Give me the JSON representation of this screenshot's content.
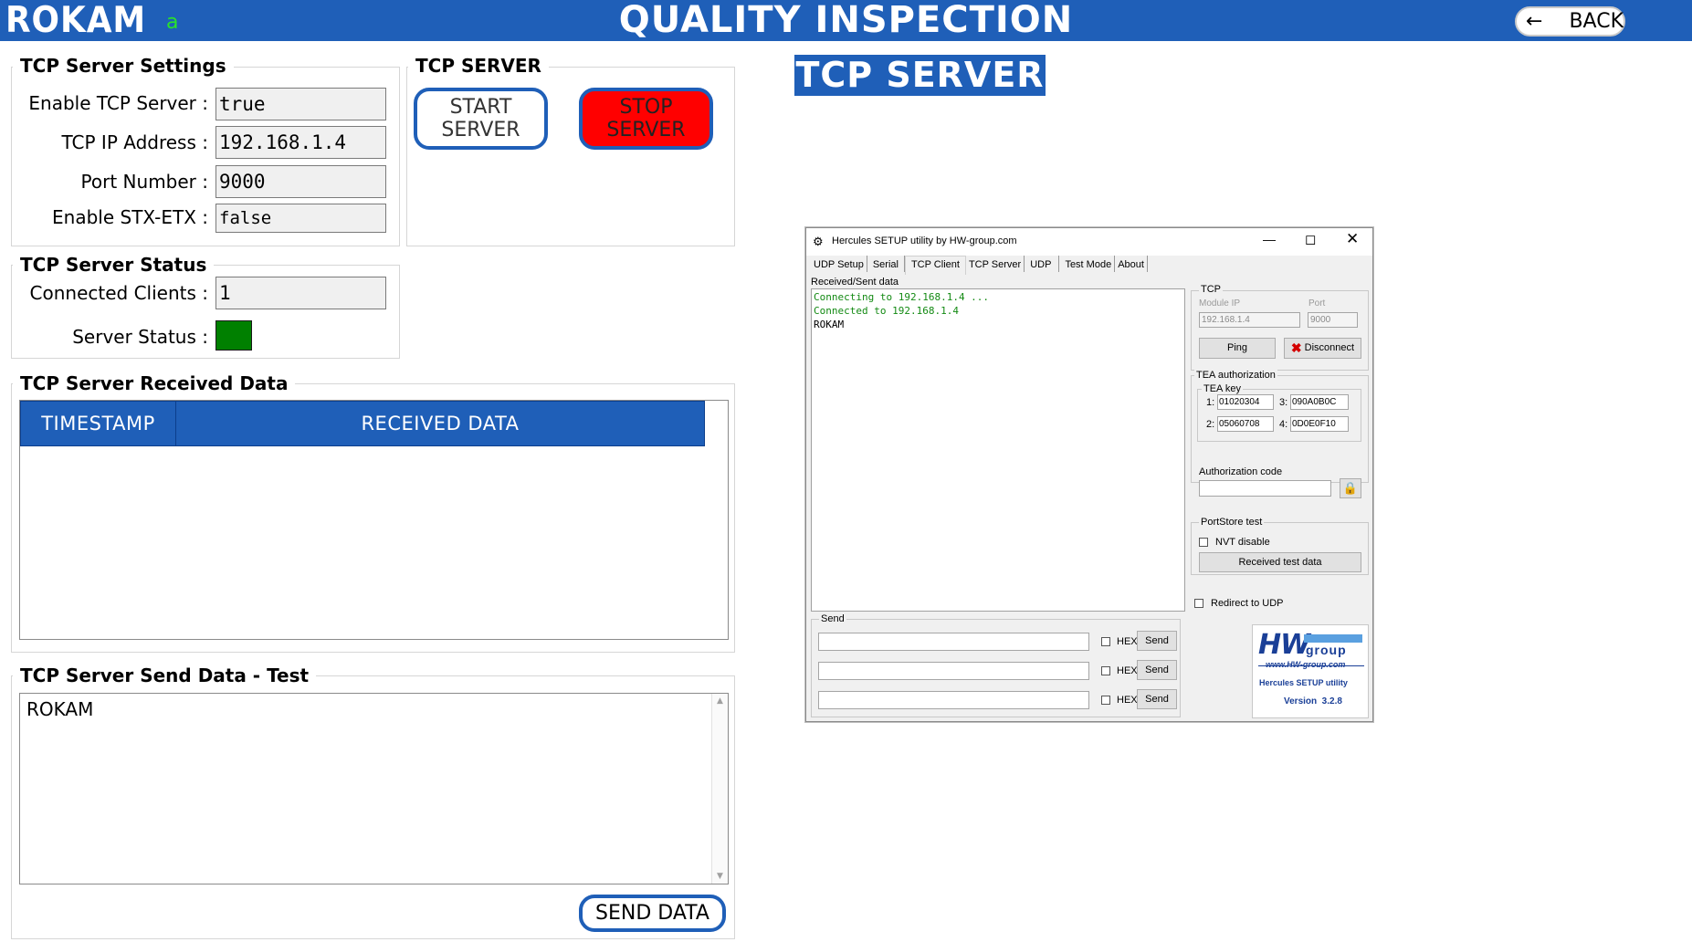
{
  "header": {
    "brand": "ROKAM",
    "brand_sub": "a",
    "title": "QUALITY INSPECTION",
    "back_label": "BACK",
    "back_icon": "arrow-left-icon"
  },
  "settings": {
    "title": "TCP Server Settings",
    "rows": [
      {
        "label": "Enable TCP Server :",
        "value": "true"
      },
      {
        "label": "TCP IP Address :",
        "value": "192.168.1.4"
      },
      {
        "label": "Port Number :",
        "value": "9000"
      },
      {
        "label": "Enable STX-ETX :",
        "value": "false"
      }
    ]
  },
  "server_ctrl": {
    "title": "TCP SERVER",
    "start_label": "START SERVER",
    "stop_label": "STOP SERVER"
  },
  "heading": "TCP SERVER",
  "status": {
    "title": "TCP Server Status",
    "clients_label": "Connected Clients :",
    "clients_value": "1",
    "status_label": "Server Status :",
    "status_color": "#008000"
  },
  "received": {
    "title": "TCP Server Received Data",
    "columns": [
      "TIMESTAMP",
      "RECEIVED DATA"
    ]
  },
  "send": {
    "title": "TCP Server Send Data - Test",
    "text": "ROKAM",
    "button": "SEND DATA"
  },
  "colors": {
    "accent": "#1f5fb8",
    "stop": "#ff0000",
    "status_ok": "#008000"
  },
  "hercules": {
    "title": "Hercules SETUP utility by HW-group.com",
    "tabs": [
      "UDP Setup",
      "Serial",
      "TCP Client",
      "TCP Server",
      "UDP",
      "Test Mode",
      "About"
    ],
    "received_label": "Received/Sent data",
    "log": [
      "Connecting to 192.168.1.4 ...",
      "Connected to 192.168.1.4",
      "ROKAM"
    ],
    "tcp": {
      "label": "TCP",
      "module_ip_label": "Module IP",
      "module_ip": "192.168.1.4",
      "port_label": "Port",
      "port": "9000",
      "ping": "Ping",
      "disconnect": "Disconnect"
    },
    "tea": {
      "label": "TEA authorization",
      "key_label": "TEA key",
      "keys": [
        {
          "n": "1:",
          "v": "01020304"
        },
        {
          "n": "3:",
          "v": "090A0B0C"
        },
        {
          "n": "2:",
          "v": "05060708"
        },
        {
          "n": "4:",
          "v": "0D0E0F10"
        }
      ],
      "auth_label": "Authorization code"
    },
    "portstore": {
      "label": "PortStore test",
      "nvt": "NVT disable",
      "recv_btn": "Received test data"
    },
    "redirect": "Redirect to UDP",
    "send_label": "Send",
    "hex": "HEX",
    "send_btn": "Send",
    "logo": {
      "hw": "HW",
      "group": "group",
      "url": "www.HW-group.com",
      "product": "Hercules SETUP utility",
      "version": "Version  3.2.8"
    }
  }
}
